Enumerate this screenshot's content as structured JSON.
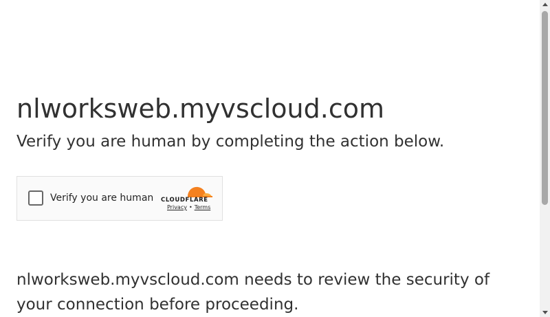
{
  "page": {
    "domain_title": "nlworksweb.myvscloud.com",
    "subtitle": "Verify you are human by completing the action below.",
    "notice": "nlworksweb.myvscloud.com needs to review the security of your connection before proceeding."
  },
  "widget": {
    "checkbox_label": "Verify you are human",
    "brand": "CLOUDFLARE",
    "privacy_link": "Privacy",
    "separator": "•",
    "terms_link": "Terms",
    "checkbox_checked": false
  },
  "colors": {
    "text": "#313131",
    "cloudflare_orange": "#f48120",
    "cloudflare_orange_light": "#faad3f",
    "widget_border": "#e0e0e0",
    "widget_bg": "#fafafa"
  },
  "icons": {
    "cloud": "cloudflare-cloud-icon"
  }
}
